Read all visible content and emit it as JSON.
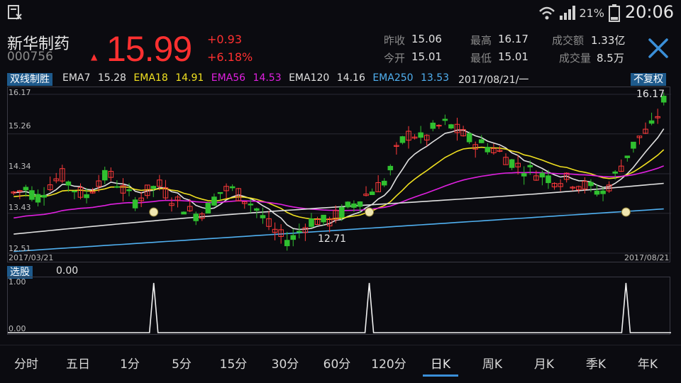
{
  "status": {
    "battery_pct": "21%",
    "time": "20:06"
  },
  "stock": {
    "name": "新华制药",
    "code": "000756",
    "price": "15.99",
    "change": "+0.93",
    "change_pct": "+6.18%"
  },
  "stats": [
    {
      "label": "昨收",
      "value": "15.06"
    },
    {
      "label": "今开",
      "value": "15.01"
    },
    {
      "label": "最高",
      "value": "16.17"
    },
    {
      "label": "最低",
      "value": "15.01"
    },
    {
      "label": "成交额",
      "value": "1.33亿"
    },
    {
      "label": "成交量",
      "value": "8.5万"
    }
  ],
  "indicator": {
    "name": "双线制胜",
    "ema": [
      {
        "label": "EMA7",
        "value": "15.28",
        "color": "#e0e0e0"
      },
      {
        "label": "EMA18",
        "value": "14.91",
        "color": "#f0e020"
      },
      {
        "label": "EMA56",
        "value": "14.53",
        "color": "#e020e0"
      },
      {
        "label": "EMA120",
        "value": "14.16",
        "color": "#e0e0e0"
      },
      {
        "label": "EMA250",
        "value": "13.53",
        "color": "#50b0f0"
      }
    ],
    "date": "2017/08/21/一",
    "adjust_button": "不复权"
  },
  "chart_data": {
    "type": "candlestick",
    "y_ticks": [
      "16.17",
      "15.26",
      "14.34",
      "13.43",
      "12.51"
    ],
    "ylim": [
      12.51,
      16.17
    ],
    "x_start": "2017/03/21",
    "x_end": "2017/08/21",
    "high_label": "16.17",
    "low_label": "12.71"
  },
  "sub_chart": {
    "name": "选股",
    "value": "0.00",
    "y_ticks": [
      "1.00",
      "0.00"
    ],
    "signals": [
      0.22,
      0.545,
      0.932
    ]
  },
  "tabs": [
    "分时",
    "五日",
    "1分",
    "5分",
    "15分",
    "30分",
    "60分",
    "120分",
    "日K",
    "周K",
    "月K",
    "季K",
    "年K"
  ],
  "active_tab": "日K"
}
